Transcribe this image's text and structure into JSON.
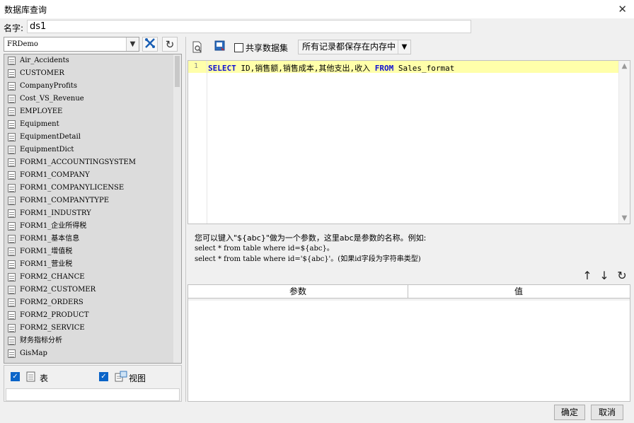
{
  "window": {
    "title": "数据库查询",
    "close_glyph": "✕"
  },
  "name_field": {
    "label": "名字:",
    "value": "ds1"
  },
  "left": {
    "datasource": "FRDemo",
    "tables": [
      "Air_Accidents",
      "CUSTOMER",
      "CompanyProfits",
      "Cost_VS_Revenue",
      "EMPLOYEE",
      "Equipment",
      "EquipmentDetail",
      "EquipmentDict",
      "FORM1_ACCOUNTINGSYSTEM",
      "FORM1_COMPANY",
      "FORM1_COMPANYLICENSE",
      "FORM1_COMPANYTYPE",
      "FORM1_INDUSTRY",
      "FORM1_企业所得税",
      "FORM1_基本信息",
      "FORM1_增值税",
      "FORM1_营业税",
      "FORM2_CHANCE",
      "FORM2_CUSTOMER",
      "FORM2_ORDERS",
      "FORM2_PRODUCT",
      "FORM2_SERVICE",
      "财务指标分析",
      "GisMap"
    ],
    "table_label": "表",
    "view_label": "视图"
  },
  "toolbar": {
    "shared_label": "共享数据集",
    "memory_option": "所有记录都保存在内存中"
  },
  "editor": {
    "line_no": "1",
    "kw_select": "SELECT",
    "cols": " ID,销售额,销售成本,其他支出,收入 ",
    "kw_from": "FROM",
    "table": " Sales_format"
  },
  "hint": {
    "line1": "您可以键入\"${abc}\"做为一个参数，这里abc是参数的名称。例如:",
    "line2": "select * from table where id=${abc}。",
    "line3": "select * from table where id='${abc}'。(如果id字段为字符串类型)"
  },
  "params": {
    "col_param": "参数",
    "col_value": "值"
  },
  "buttons": {
    "ok": "确定",
    "cancel": "取消"
  }
}
